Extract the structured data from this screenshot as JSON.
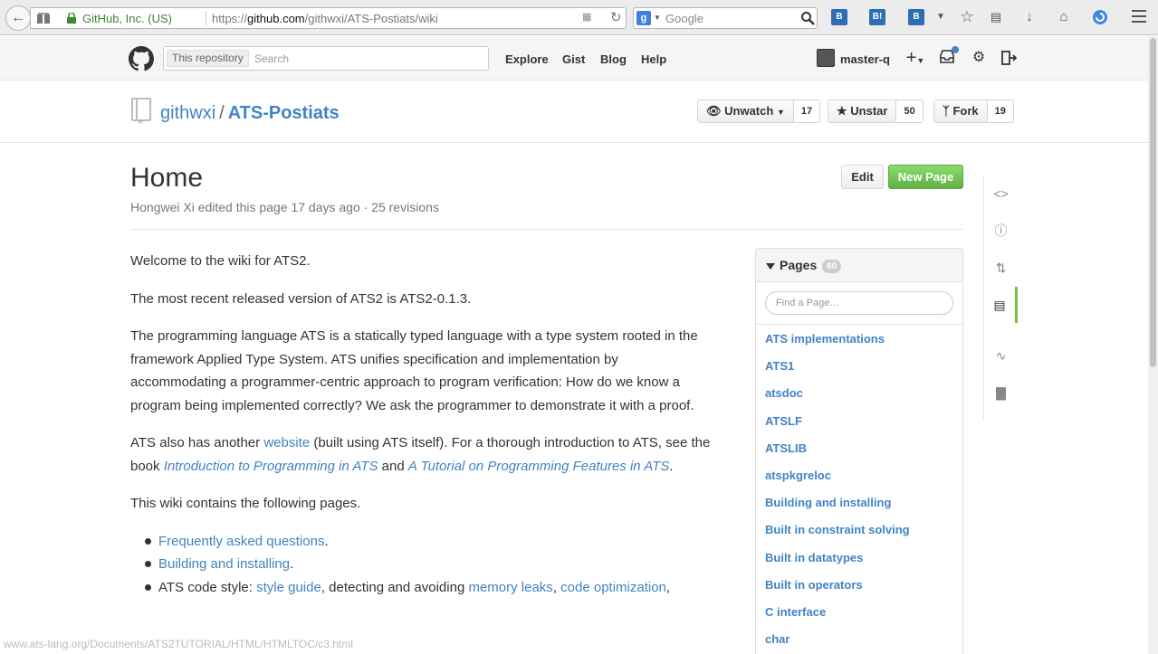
{
  "browser": {
    "identity": "GitHub, Inc. (US)",
    "url_prefix": "https://",
    "url_host": "github.com",
    "url_path": "/githwxi/ATS-Postiats/wiki",
    "search_engine_icon": "g",
    "search_placeholder": "Google",
    "status_url": "www.ats-lang.org/Documents/ATS2TUTORIAL/HTML/HTMLTOC/c3.html"
  },
  "gh_header": {
    "search_scope": "This repository",
    "search_placeholder": "Search",
    "nav": [
      "Explore",
      "Gist",
      "Blog",
      "Help"
    ],
    "username": "master-q"
  },
  "repo": {
    "owner": "githwxi",
    "separator": "/",
    "name": "ATS-Postiats",
    "watch_label": "Unwatch",
    "watch_count": "17",
    "star_label": "Unstar",
    "star_count": "50",
    "fork_label": "Fork",
    "fork_count": "19"
  },
  "wiki": {
    "title": "Home",
    "meta": "Hongwei Xi edited this page 17 days ago · 25 revisions",
    "edit_label": "Edit",
    "new_page_label": "New Page",
    "p1": "Welcome to the wiki for ATS2.",
    "p2": "The most recent released version of ATS2 is ATS2-0.1.3.",
    "p3": "The programming language ATS is a statically typed language with a type system rooted in the framework Applied Type System. ATS unifies specification and implementation by accommodating a programmer-centric approach to program verification: How do we know a program being implemented correctly? We ask the programmer to demonstrate it with a proof.",
    "p4_a": "ATS also has another ",
    "p4_link1": "website",
    "p4_b": " (built using ATS itself). For a thorough introduction to ATS, see the book ",
    "p4_link2": "Introduction to Programming in ATS",
    "p4_c": " and ",
    "p4_link3": "A Tutorial on Programming Features in ATS",
    "p4_d": ".",
    "p5": "This wiki contains the following pages.",
    "li1_link": "Frequently asked questions",
    "li1_tail": ".",
    "li2_link": "Building and installing",
    "li2_tail": ".",
    "li3_head": "ATS code style: ",
    "li3_link1": "style guide",
    "li3_mid1": ", detecting and avoiding ",
    "li3_link2": "memory leaks",
    "li3_mid2": ", ",
    "li3_link3": "code optimization",
    "li3_tail": ","
  },
  "pages": {
    "label": "Pages",
    "count": "60",
    "find_placeholder": "Find a Page…",
    "items": [
      "ATS implementations",
      "ATS1",
      "atsdoc",
      "ATSLF",
      "ATSLIB",
      "atspkgreloc",
      "Building and installing",
      "Built in constraint solving",
      "Built in datatypes",
      "Built in operators",
      "C interface",
      "char"
    ]
  },
  "colors": {
    "link": "#4183c4",
    "green_button": "#6cc644",
    "secure_green": "#3b8a2f"
  }
}
